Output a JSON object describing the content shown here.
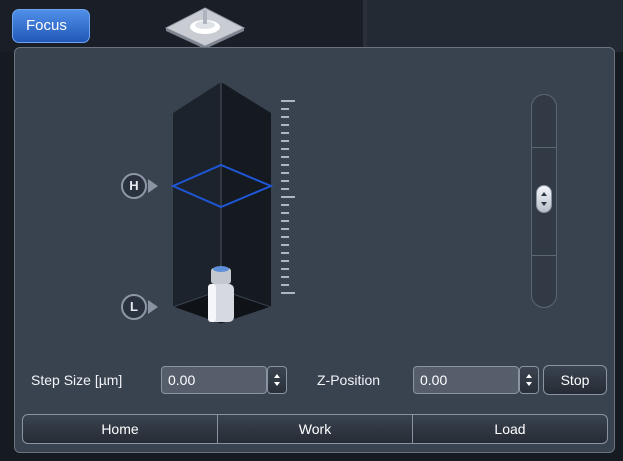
{
  "tab": {
    "focus_label": "Focus"
  },
  "markers": {
    "high": "H",
    "low": "L"
  },
  "step_size": {
    "label": "Step Size [µm]",
    "value": "0.00"
  },
  "z_position": {
    "label": "Z-Position",
    "value": "0.00"
  },
  "buttons": {
    "stop": "Stop"
  },
  "positions": [
    {
      "label": "Home"
    },
    {
      "label": "Work"
    },
    {
      "label": "Load"
    }
  ],
  "colors": {
    "accent": "#2f6fd6",
    "panel": "#39424f",
    "focus_plane": "#1e56d6"
  },
  "icons": {
    "stage": "stage-icon",
    "objective": "objective-icon",
    "slider": "vertical-slider"
  }
}
